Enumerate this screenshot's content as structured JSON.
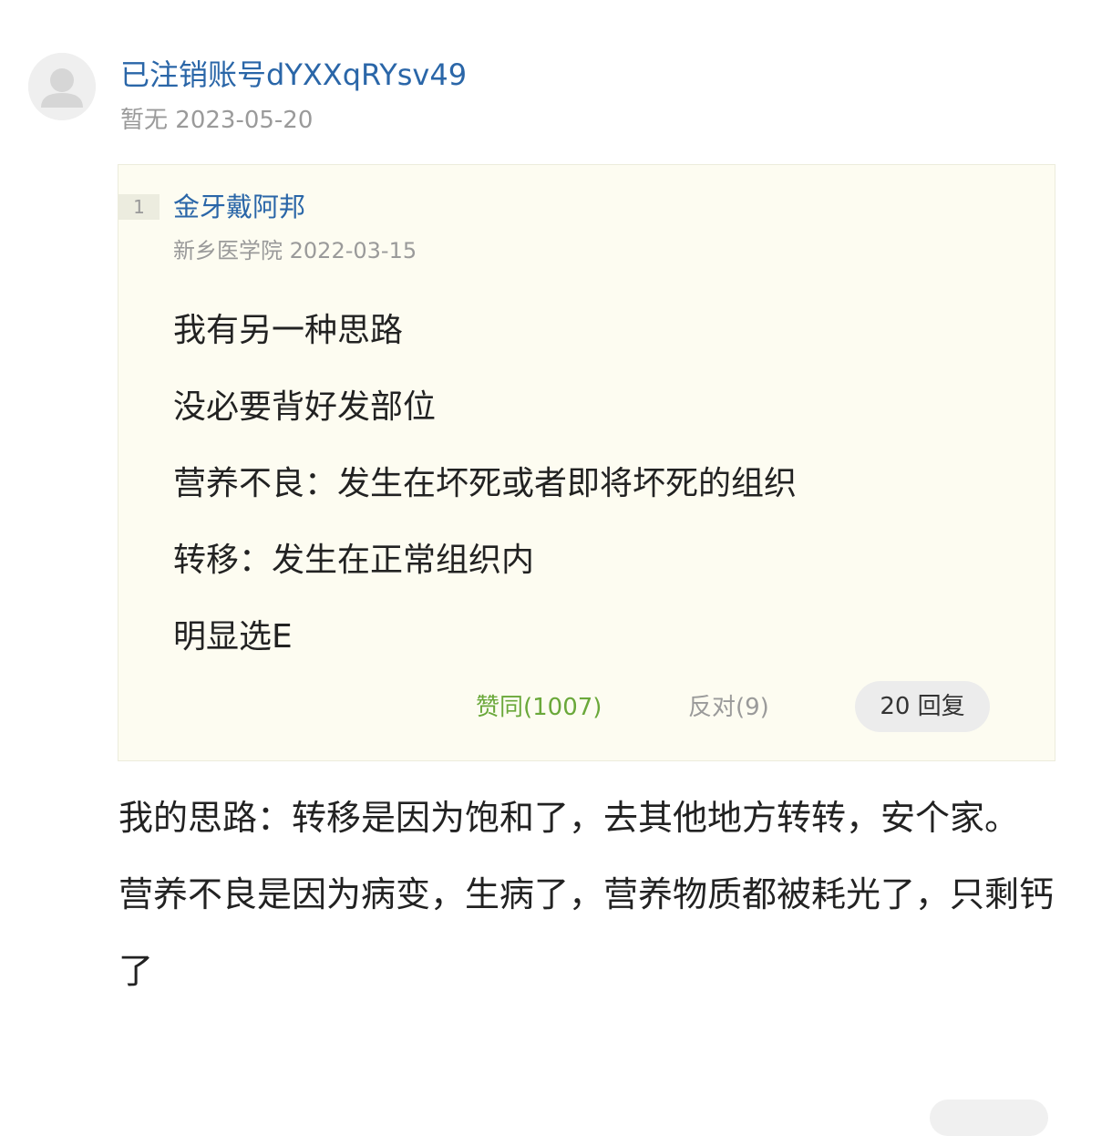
{
  "comment": {
    "author": "已注销账号dYXXqRYsv49",
    "school": "暂无",
    "date": "2023-05-20",
    "avatar_icon": "default-user-avatar-icon",
    "quote": {
      "floor": "1",
      "author": "金牙戴阿邦",
      "school": "新乡医学院",
      "date": "2022-03-15",
      "lines": [
        "我有另一种思路",
        "没必要背好发部位",
        "营养不良：发生在坏死或者即将坏死的组织",
        "转移：发生在正常组织内",
        "明显选E"
      ],
      "agree_label": "赞同(1007)",
      "oppose_label": "反对(9)",
      "reply_label": "20 回复"
    },
    "paragraphs": [
      "我的思路：转移是因为饱和了，去其他地方转转，安个家。",
      "营养不良是因为病变，生病了，营养物质都被耗光了，只剩钙了"
    ]
  },
  "colors": {
    "link": "#2a66a8",
    "meta": "#9a9a9a",
    "agree": "#6aa83a",
    "quote_bg": "#fdfcf1"
  }
}
